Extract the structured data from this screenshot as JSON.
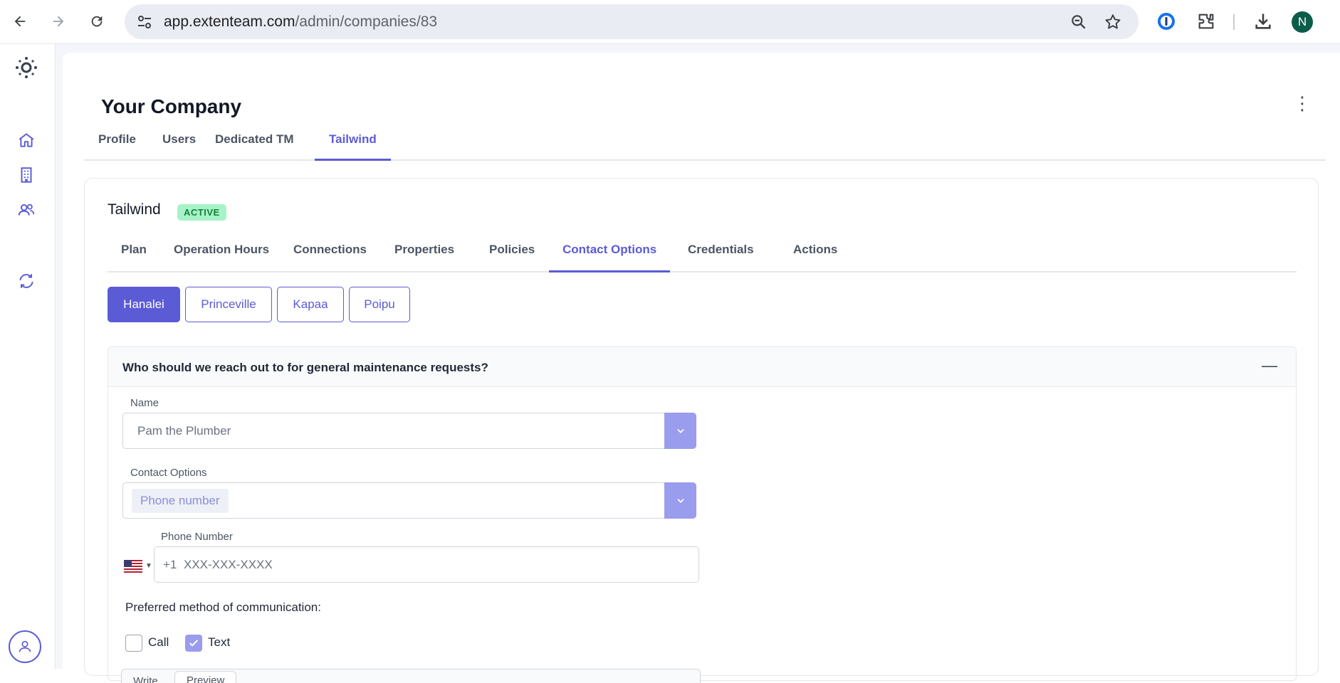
{
  "browser": {
    "url_host": "app.extenteam.com",
    "url_path": "/admin/companies/83",
    "profile_initial": "N"
  },
  "page": {
    "title": "Your Company",
    "tabs": [
      {
        "label": "Profile"
      },
      {
        "label": "Users"
      },
      {
        "label": "Dedicated TM"
      },
      {
        "label": "Tailwind"
      }
    ]
  },
  "card": {
    "title": "Tailwind",
    "status": "ACTIVE",
    "tabs": [
      {
        "label": "Plan"
      },
      {
        "label": "Operation Hours"
      },
      {
        "label": "Connections"
      },
      {
        "label": "Properties"
      },
      {
        "label": "Policies"
      },
      {
        "label": "Contact Options"
      },
      {
        "label": "Credentials"
      },
      {
        "label": "Actions"
      }
    ],
    "locations": [
      {
        "label": "Hanalei"
      },
      {
        "label": "Princeville"
      },
      {
        "label": "Kapaa"
      },
      {
        "label": "Poipu"
      }
    ]
  },
  "section": {
    "question": "Who should we reach out to for general maintenance requests?",
    "collapse_symbol": "—",
    "name_label": "Name",
    "name_value": "Pam the Plumber",
    "contact_label": "Contact Options",
    "contact_value": "Phone number",
    "phone_label": "Phone Number",
    "phone_country_code": "+1",
    "phone_placeholder": "XXX-XXX-XXXX",
    "pref_label": "Preferred method of communication:",
    "options": [
      {
        "label": "Call",
        "checked": false
      },
      {
        "label": "Text",
        "checked": true
      }
    ],
    "editor_tabs": [
      {
        "label": "Write"
      },
      {
        "label": "Preview"
      }
    ]
  },
  "colors": {
    "accent": "#5b5bd6",
    "accent_light": "#9a9cee",
    "badge_bg": "#a7f3c8",
    "badge_text": "#15803d"
  }
}
